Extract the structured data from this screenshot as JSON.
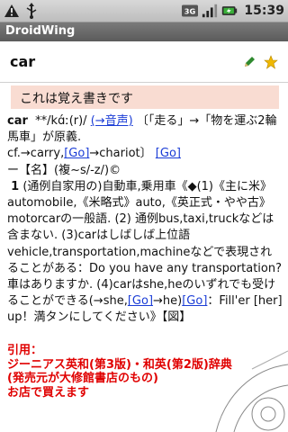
{
  "status": {
    "time": "15:39",
    "network": "3G"
  },
  "app": {
    "title": "DroidWing"
  },
  "entry": {
    "word": "car",
    "memo": "これは覚え書きです",
    "headword": "car",
    "pron": "**/kɑ́ː(r)/",
    "audio_link": "(→音声)",
    "etym_part1": "〔「走る」→「物を運ぶ2輪馬車」が原義.",
    "etym_part2": "cf.→carry,",
    "go1": "[Go]",
    "etym_part3": "→chariot〕",
    "go2": "[Go]",
    "pos": "ー【名】(複~s/-z/)©",
    "sense_num": "1",
    "sense_text": " (通例自家用の)自動車,乗用車《◆(1)《主に米》automobile,《米略式》auto,《英正式・やや古》motorcarの一般語. (2) 通例bus,taxi,truckなどは含まない. (3)carはしばしば上位語vehicle,transportation,machineなどで表現されることがある：Do you have any transportation?車はありますか. (4)carはshe,heのいずれでも受けることができる(→she,",
    "go3": "[Go]",
    "mid_text": "→he)",
    "go4": "[Go]",
    "tail_text": "：Fill'er [her] up！満タンにしてください》【図】"
  },
  "quote": {
    "line1": "引用：",
    "line2": "ジーニアス英和(第3版)・和英(第2版)辞典",
    "line3": "(発売元が大修館書店のもの)",
    "line4": "お店で買えます"
  }
}
